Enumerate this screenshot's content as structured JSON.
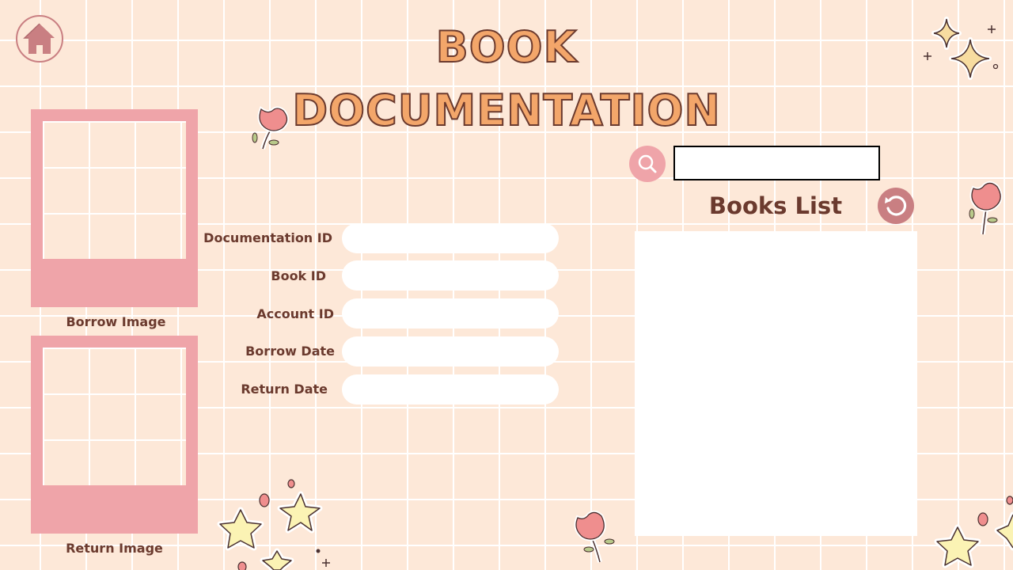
{
  "header": {
    "title": "BOOK DOCUMENTATION",
    "home_icon": "home-icon"
  },
  "images": {
    "borrow_label": "Borrow Image",
    "return_label": "Return Image"
  },
  "form": {
    "fields": [
      {
        "label": "Documentation ID",
        "value": ""
      },
      {
        "label": "Book ID",
        "value": ""
      },
      {
        "label": "Account ID",
        "value": ""
      },
      {
        "label": "Borrow Date",
        "value": ""
      },
      {
        "label": "Return Date",
        "value": ""
      }
    ]
  },
  "books": {
    "title": "Books List",
    "search_value": "",
    "search_icon": "search-icon",
    "refresh_icon": "refresh-icon",
    "items": []
  },
  "colors": {
    "background": "#fde8d8",
    "grid": "#ffffff",
    "accent_pink": "#efa4a9",
    "dark_pink": "#c97f82",
    "text_brown": "#6b3a2e",
    "title_orange": "#f3a66a"
  }
}
